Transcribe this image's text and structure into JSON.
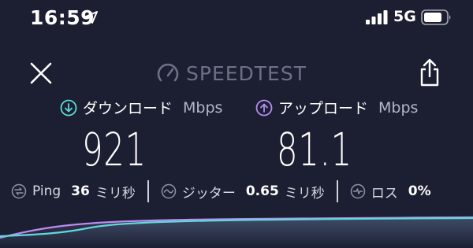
{
  "status_bar": {
    "time": "16:59",
    "network": "5G",
    "icons": [
      "location-arrow-icon",
      "signal-bars-icon",
      "battery-icon"
    ]
  },
  "header": {
    "brand": "SPEEDTEST",
    "icons": [
      "close-icon",
      "speedometer-icon",
      "share-icon"
    ]
  },
  "download": {
    "label": "ダウンロード",
    "unit": "Mbps",
    "value": "921",
    "color": "#5fd8d8",
    "icon": "arrow-down-circle-icon"
  },
  "upload": {
    "label": "アップロード",
    "unit": "Mbps",
    "value": "81.1",
    "color": "#b88cf0",
    "icon": "arrow-up-circle-icon"
  },
  "stats": {
    "ping": {
      "label": "Ping",
      "value": "36",
      "unit": "ミリ秒",
      "icon": "ping-icon"
    },
    "jitter": {
      "label": "ジッター",
      "value": "0.65",
      "unit": "ミリ秒",
      "icon": "jitter-icon"
    },
    "loss": {
      "label": "ロス",
      "value": "0%",
      "icon": "loss-icon"
    }
  },
  "colors": {
    "background": "#1c1f31",
    "brand_gray": "#6e7185",
    "download_line": "#5fd8d8",
    "upload_line": "#b88cf0"
  }
}
